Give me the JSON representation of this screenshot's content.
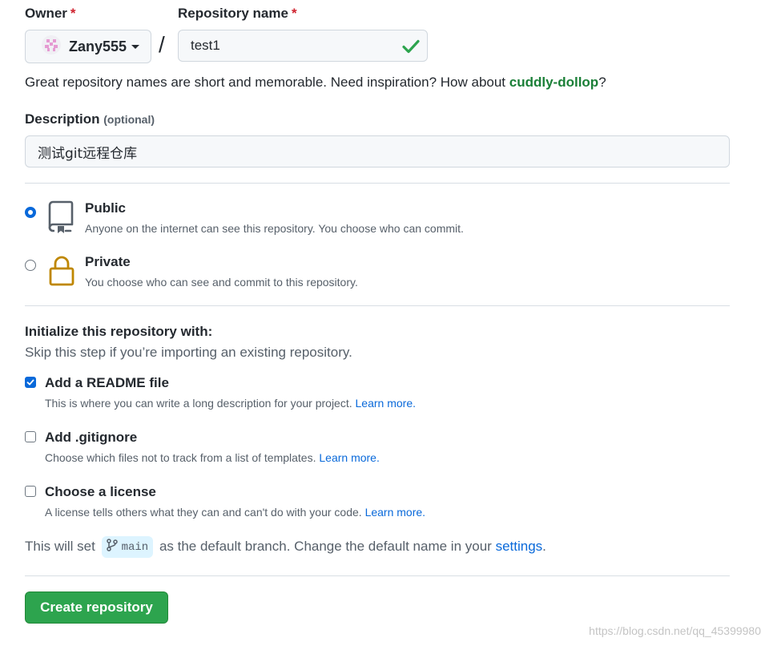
{
  "owner": {
    "label": "Owner",
    "required_mark": "*",
    "name": "Zany555"
  },
  "separator": "/",
  "repository": {
    "label": "Repository name",
    "required_mark": "*",
    "value": "test1"
  },
  "name_hint": {
    "text": "Great repository names are short and memorable. Need inspiration? How about ",
    "suggestion": "cuddly-dollop",
    "suffix": "?"
  },
  "description": {
    "label": "Description",
    "optional": "(optional)",
    "value": "测试git远程仓库"
  },
  "visibility": {
    "public": {
      "title": "Public",
      "subtitle": "Anyone on the internet can see this repository. You choose who can commit.",
      "icon": "repo-icon",
      "selected": true
    },
    "private": {
      "title": "Private",
      "subtitle": "You choose who can see and commit to this repository.",
      "icon": "lock-icon",
      "selected": false
    }
  },
  "initialize": {
    "heading": "Initialize this repository with:",
    "subheading": "Skip this step if you’re importing an existing repository.",
    "readme": {
      "title": "Add a README file",
      "desc": "This is where you can write a long description for your project. ",
      "link": "Learn more.",
      "checked": true
    },
    "gitignore": {
      "title": "Add .gitignore",
      "desc": "Choose which files not to track from a list of templates. ",
      "link": "Learn more.",
      "checked": false
    },
    "license": {
      "title": "Choose a license",
      "desc": "A license tells others what they can and can't do with your code. ",
      "link": "Learn more.",
      "checked": false
    }
  },
  "branch": {
    "prefix": "This will set",
    "name": "main",
    "middle": "as the default branch. Change the default name in your",
    "link": "settings",
    "suffix": "."
  },
  "create_button": "Create repository",
  "watermark": "https://blog.csdn.net/qq_45399980",
  "colors": {
    "accent": "#0969da",
    "success": "#2da44e",
    "suggestion": "#1a7f37",
    "lock": "#bf8700"
  }
}
